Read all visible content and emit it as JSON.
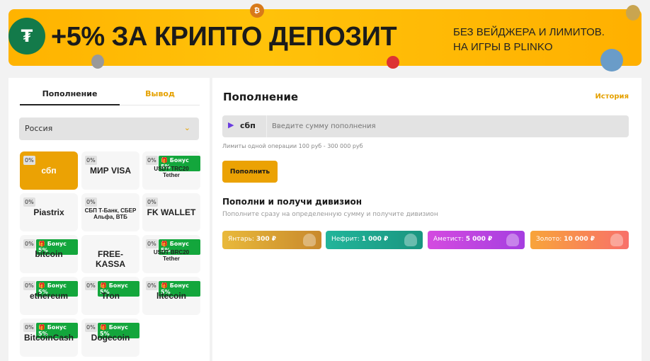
{
  "banner": {
    "headline": "+5% ЗА КРИПТО ДЕПОЗИТ",
    "sub_line1": "БЕЗ ВЕЙДЖЕРА И ЛИМИТОВ.",
    "sub_line2": "НА ИГРЫ В PLINKO"
  },
  "sidebar": {
    "tabs": [
      {
        "label": "Пополнение",
        "active": true
      },
      {
        "label": "Вывод",
        "active": false
      }
    ],
    "country": "Россия",
    "methods": [
      {
        "logo": "сбп",
        "fee": "0%",
        "bonus": null,
        "active": true
      },
      {
        "logo": "МИР VISA",
        "fee": "0%",
        "bonus": null
      },
      {
        "logo": "USDT TRC20 Tether",
        "fee": "0%",
        "bonus": "Бонус 5%"
      },
      {
        "logo": "Piastrix",
        "fee": "0%",
        "bonus": null
      },
      {
        "logo": "СБП Т-Банк, СБЕР Альфа, ВТБ",
        "fee": "0%",
        "bonus": null
      },
      {
        "logo": "FK WALLET",
        "fee": "0%",
        "bonus": null
      },
      {
        "logo": "bitcoin",
        "fee": "0%",
        "bonus": "Бонус 5%"
      },
      {
        "logo": "FREE-KASSA",
        "fee": null,
        "bonus": null
      },
      {
        "logo": "USDT BRC20 Tether",
        "fee": "0%",
        "bonus": "Бонус 5%"
      },
      {
        "logo": "ethereum",
        "fee": "0%",
        "bonus": "Бонус 5%"
      },
      {
        "logo": "Tron",
        "fee": "0%",
        "bonus": "Бонус 5%"
      },
      {
        "logo": "litecoin",
        "fee": "0%",
        "bonus": "Бонус 5%"
      },
      {
        "logo": "BitcoinCash",
        "fee": "0%",
        "bonus": "Бонус 5%"
      },
      {
        "logo": "Dogecoin",
        "fee": "0%",
        "bonus": "Бонус 5%"
      }
    ]
  },
  "main": {
    "title": "Пополнение",
    "history_link": "История",
    "method_logo": "сбп",
    "amount_placeholder": "Введите сумму пополнения",
    "limits": "Лимиты одной операции 100 руб - 300 000 руб",
    "submit": "Пополнить",
    "divisions_title": "Пополни и получи дивизион",
    "divisions_desc": "Пополните сразу на определенную сумму и получите дивизион",
    "divisions": [
      {
        "name": "Янтарь:",
        "amount": "300 ₽",
        "colors": [
          "#e9b93a",
          "#c8892d"
        ]
      },
      {
        "name": "Нефрит:",
        "amount": "1 000 ₽",
        "colors": [
          "#22b59a",
          "#1a9580"
        ]
      },
      {
        "name": "Аметист:",
        "amount": "5 000 ₽",
        "colors": [
          "#d44be0",
          "#a53ee0"
        ]
      },
      {
        "name": "Золото:",
        "amount": "10 000 ₽",
        "colors": [
          "#f8a43a",
          "#f8706a"
        ]
      }
    ]
  },
  "colors": {
    "accent": "#eba204",
    "bonus": "#13a63c"
  }
}
